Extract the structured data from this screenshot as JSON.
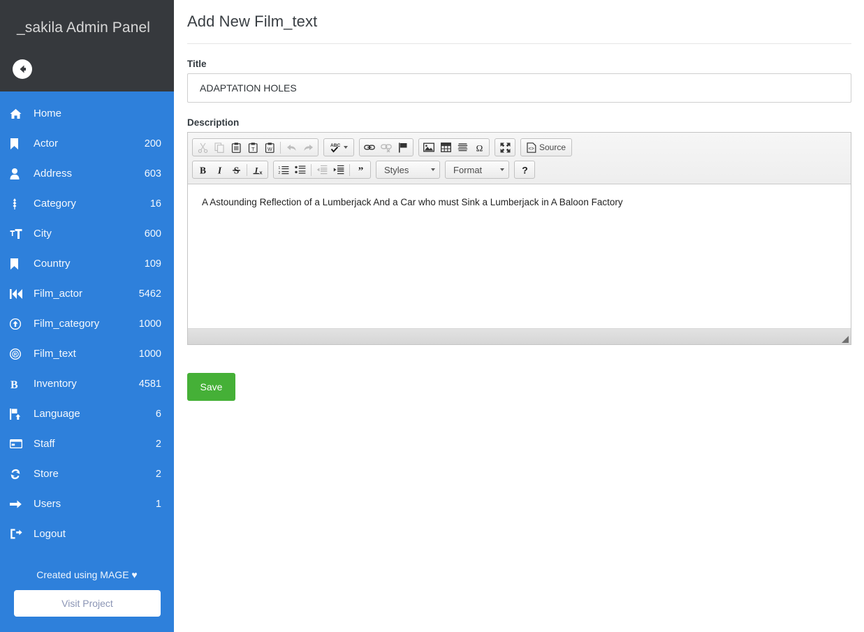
{
  "sidebar": {
    "brand_title": "_sakila Admin Panel",
    "back_icon": "arrow-circle-left-icon",
    "items": [
      {
        "icon": "home-icon",
        "label": "Home",
        "count": ""
      },
      {
        "icon": "bookmark-icon",
        "label": "Actor",
        "count": "200"
      },
      {
        "icon": "user-icon",
        "label": "Address",
        "count": "603"
      },
      {
        "icon": "sprout-icon",
        "label": "Category",
        "count": "16"
      },
      {
        "icon": "text-format-icon",
        "label": "City",
        "count": "600"
      },
      {
        "icon": "bookmark-icon",
        "label": "Country",
        "count": "109"
      },
      {
        "icon": "fast-backward-icon",
        "label": "Film_actor",
        "count": "5462"
      },
      {
        "icon": "arrow-up-circle-icon",
        "label": "Film_category",
        "count": "1000"
      },
      {
        "icon": "registered-icon",
        "label": "Film_text",
        "count": "1000"
      },
      {
        "icon": "bold-b-icon",
        "label": "Inventory",
        "count": "4581"
      },
      {
        "icon": "flag-upload-icon",
        "label": "Language",
        "count": "6"
      },
      {
        "icon": "card-icon",
        "label": "Staff",
        "count": "2"
      },
      {
        "icon": "refresh-icon",
        "label": "Store",
        "count": "2"
      },
      {
        "icon": "arrow-right-icon",
        "label": "Users",
        "count": "1"
      },
      {
        "icon": "logout-icon",
        "label": "Logout",
        "count": ""
      }
    ],
    "footer_note": "Created using MAGE ♥",
    "visit_button": "Visit Project"
  },
  "main": {
    "page_title": "Add New Film_text",
    "title_field": {
      "label": "Title",
      "value": "ADAPTATION HOLES"
    },
    "description_field": {
      "label": "Description",
      "content": "A Astounding Reflection of a Lumberjack And a Car who must Sink a Lumberjack in A Baloon Factory"
    },
    "save_button": "Save"
  },
  "editor": {
    "toolbar_row1": {
      "clipboard": [
        "cut-icon",
        "copy-icon",
        "paste-icon",
        "paste-text-icon",
        "paste-word-icon",
        "undo-icon",
        "redo-icon"
      ],
      "spellcheck_label": "ABC",
      "links": [
        "link-icon",
        "unlink-icon",
        "anchor-flag-icon"
      ],
      "insert": [
        "image-icon",
        "table-icon",
        "horizontal-rule-icon",
        "special-char-icon"
      ],
      "maximize": "maximize-icon",
      "source_label": "Source",
      "source_icon": "source-code-icon"
    },
    "toolbar_row2": {
      "basic": [
        "bold-icon",
        "italic-icon",
        "strike-icon",
        "remove-format-icon"
      ],
      "lists": [
        "numbered-list-icon",
        "bulleted-list-icon",
        "outdent-icon",
        "indent-icon",
        "blockquote-icon"
      ],
      "styles_label": "Styles",
      "format_label": "Format",
      "help_label": "?"
    }
  },
  "colors": {
    "sidebar_blue": "#2e80db",
    "sidebar_header_dark": "#36393d",
    "save_green": "#45b037"
  }
}
